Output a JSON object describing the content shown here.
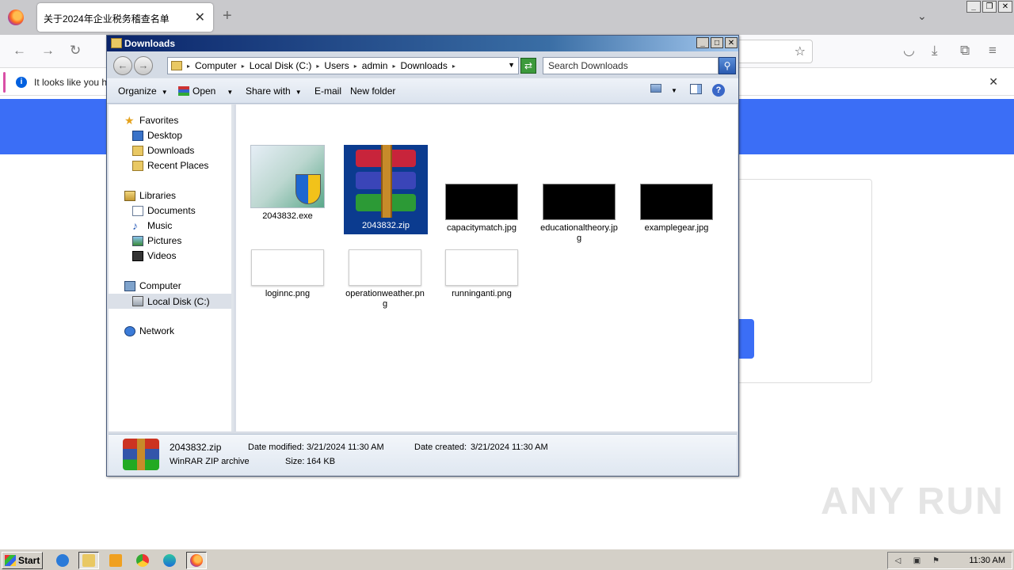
{
  "browser": {
    "tab_title": "关于2024年企业税务稽查名单",
    "notification_text": "It looks like you ha",
    "tab_close": "✕",
    "new_tab": "+",
    "tab_list": "⌄",
    "notif_close": "✕"
  },
  "explorer": {
    "title": "Downloads",
    "breadcrumb": [
      "Computer",
      "Local Disk (C:)",
      "Users",
      "admin",
      "Downloads"
    ],
    "search_placeholder": "Search Downloads",
    "toolbar": {
      "organize": "Organize",
      "open": "Open",
      "share_with": "Share with",
      "email": "E-mail",
      "new_folder": "New folder"
    },
    "nav": {
      "favorites": "Favorites",
      "desktop": "Desktop",
      "downloads": "Downloads",
      "recent_places": "Recent Places",
      "libraries": "Libraries",
      "documents": "Documents",
      "music": "Music",
      "pictures": "Pictures",
      "videos": "Videos",
      "computer": "Computer",
      "local_disk": "Local Disk (C:)",
      "network": "Network"
    },
    "files": [
      {
        "name": "2043832.exe"
      },
      {
        "name": "2043832.zip"
      },
      {
        "name": "capacitymatch.jpg"
      },
      {
        "name": "educationaltheory.jpg"
      },
      {
        "name": "examplegear.jpg"
      },
      {
        "name": "loginnc.png"
      },
      {
        "name": "operationweather.png"
      },
      {
        "name": "runninganti.png"
      }
    ],
    "details": {
      "name": "2043832.zip",
      "type": "WinRAR ZIP archive",
      "modified_label": "Date modified:",
      "modified": "3/21/2024 11:30 AM",
      "created_label": "Date created:",
      "created": "3/21/2024 11:30 AM",
      "size_label": "Size:",
      "size": "164 KB"
    }
  },
  "taskbar": {
    "start": "Start",
    "clock": "11:30 AM"
  },
  "watermark": "ANY RUN",
  "colors": {
    "accent_blue": "#3b6ef6",
    "selection": "#0b3b8f"
  }
}
